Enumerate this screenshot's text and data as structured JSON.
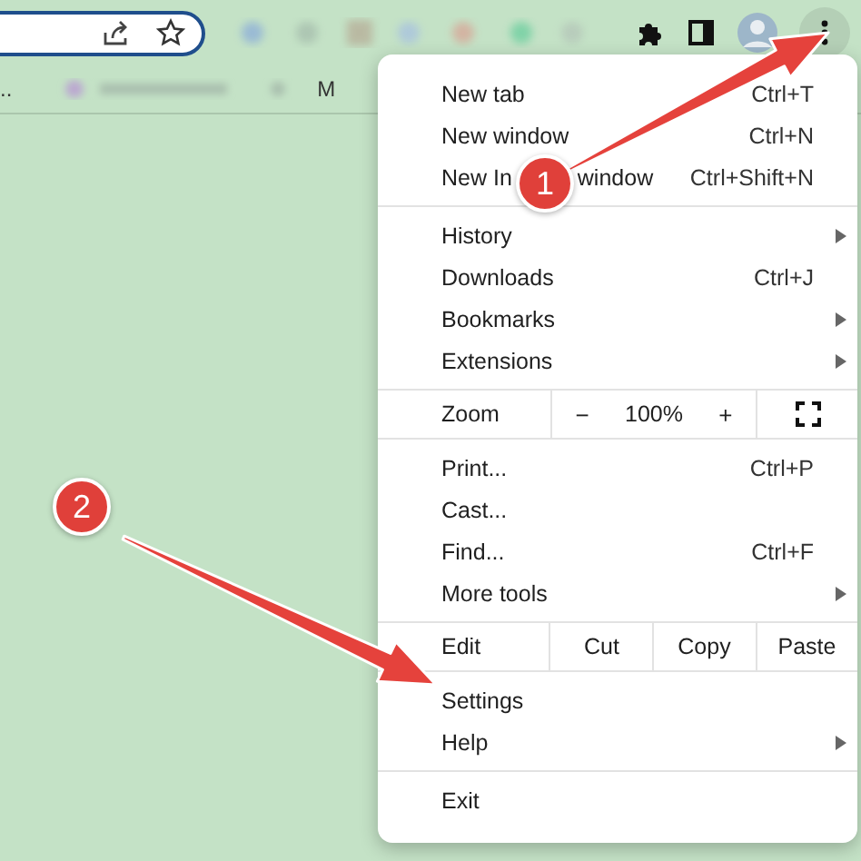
{
  "toolbar": {
    "bookmarks_bar": {
      "overflow": "..",
      "item": "M"
    }
  },
  "menu": {
    "sections": [
      {
        "kind": "items",
        "items": [
          {
            "label": "New tab",
            "shortcut": "Ctrl+T",
            "submenu": false
          },
          {
            "label": "New window",
            "shortcut": "Ctrl+N",
            "submenu": false
          },
          {
            "label": "New In",
            "label_end": "window",
            "shortcut": "Ctrl+Shift+N",
            "submenu": false
          }
        ]
      },
      {
        "kind": "items",
        "items": [
          {
            "label": "History",
            "submenu": true
          },
          {
            "label": "Downloads",
            "shortcut": "Ctrl+J",
            "submenu": false
          },
          {
            "label": "Bookmarks",
            "submenu": true
          },
          {
            "label": "Extensions",
            "submenu": true
          }
        ]
      },
      {
        "kind": "zoom",
        "label": "Zoom",
        "minus": "−",
        "value": "100%",
        "plus": "+"
      },
      {
        "kind": "items",
        "items": [
          {
            "label": "Print...",
            "shortcut": "Ctrl+P",
            "submenu": false
          },
          {
            "label": "Cast...",
            "submenu": false
          },
          {
            "label": "Find...",
            "shortcut": "Ctrl+F",
            "submenu": false
          },
          {
            "label": "More tools",
            "submenu": true
          }
        ]
      },
      {
        "kind": "edit",
        "label": "Edit",
        "buttons": [
          "Cut",
          "Copy",
          "Paste"
        ]
      },
      {
        "kind": "items",
        "items": [
          {
            "label": "Settings",
            "submenu": false
          },
          {
            "label": "Help",
            "submenu": true
          }
        ]
      },
      {
        "kind": "items",
        "items": [
          {
            "label": "Exit",
            "submenu": false
          }
        ]
      }
    ]
  },
  "annotations": [
    {
      "number": "1"
    },
    {
      "number": "2"
    }
  ]
}
